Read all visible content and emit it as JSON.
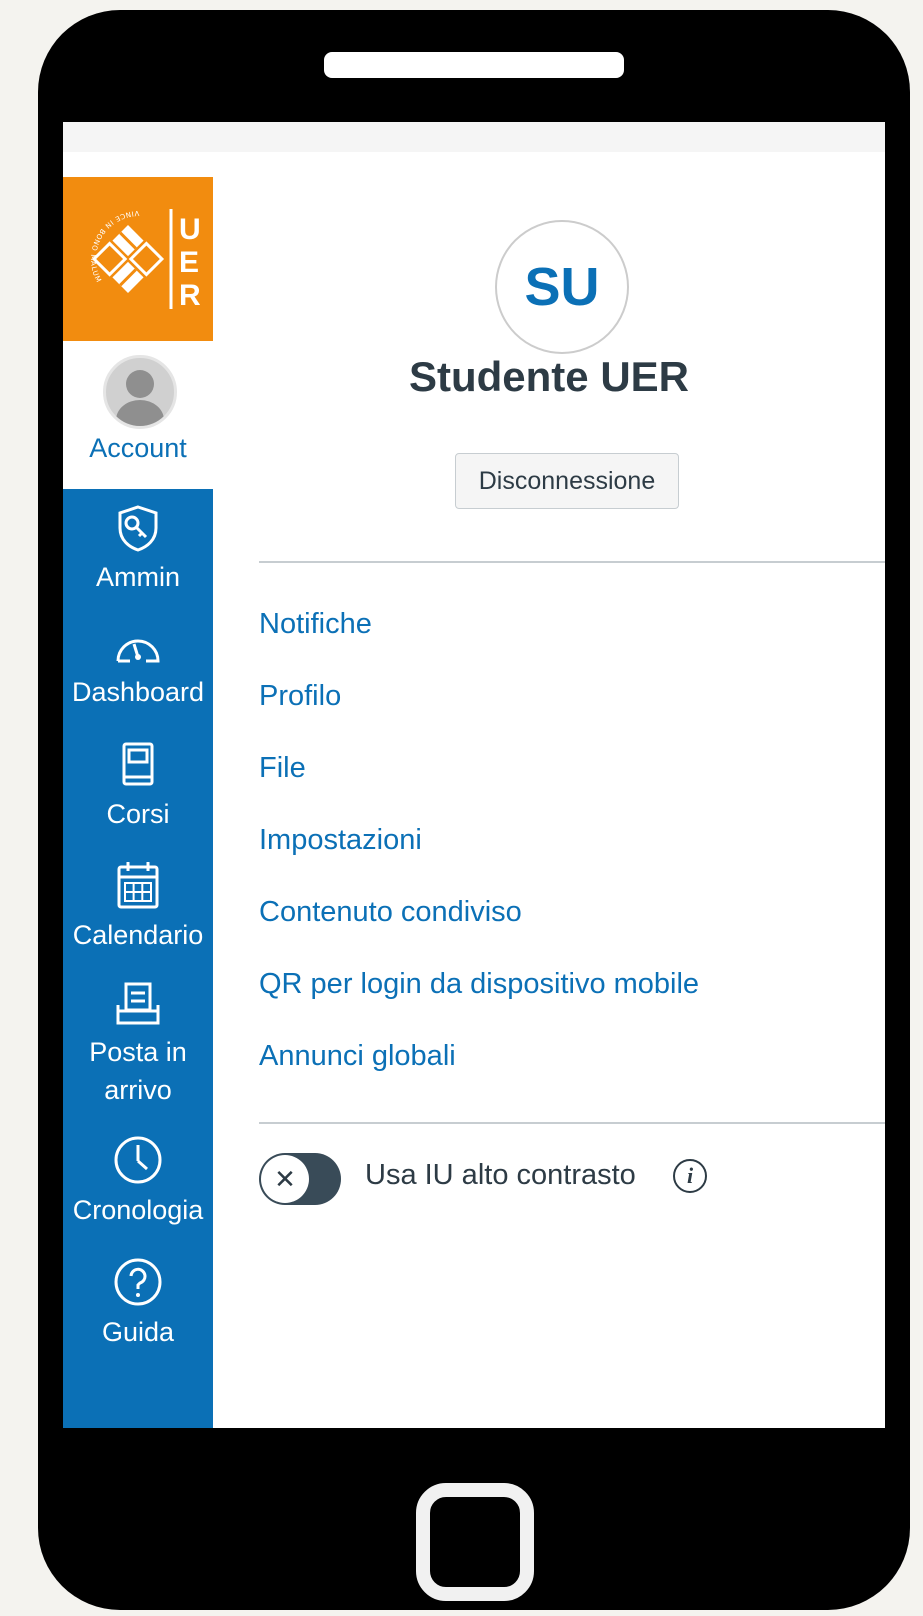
{
  "logo": {
    "letters": [
      "U",
      "E",
      "R"
    ],
    "seal_text": "VINCE IN BONO MALUM"
  },
  "account": {
    "label": "Account"
  },
  "nav": [
    {
      "label": "Ammin",
      "icon": "shield-key-icon"
    },
    {
      "label": "Dashboard",
      "icon": "speedometer-icon"
    },
    {
      "label": "Corsi",
      "icon": "book-icon"
    },
    {
      "label": "Calendario",
      "icon": "calendar-icon"
    },
    {
      "label": "Posta in arrivo",
      "icon": "inbox-icon"
    },
    {
      "label": "Cronologia",
      "icon": "clock-icon"
    },
    {
      "label": "Guida",
      "icon": "help-icon"
    }
  ],
  "profile": {
    "initials": "SU",
    "name": "Studente UER",
    "logout_label": "Disconnessione"
  },
  "links": [
    "Notifiche",
    "Profilo",
    "File",
    "Impostazioni",
    "Contenuto condiviso",
    "QR per login da dispositivo mobile",
    "Annunci globali"
  ],
  "high_contrast": {
    "label": "Usa IU alto contrasto",
    "enabled": false,
    "knob_symbol": "✕",
    "info_symbol": "i"
  },
  "colors": {
    "brand_blue": "#0b70b6",
    "brand_orange": "#f28c0f",
    "text_dark": "#2d3b45"
  }
}
